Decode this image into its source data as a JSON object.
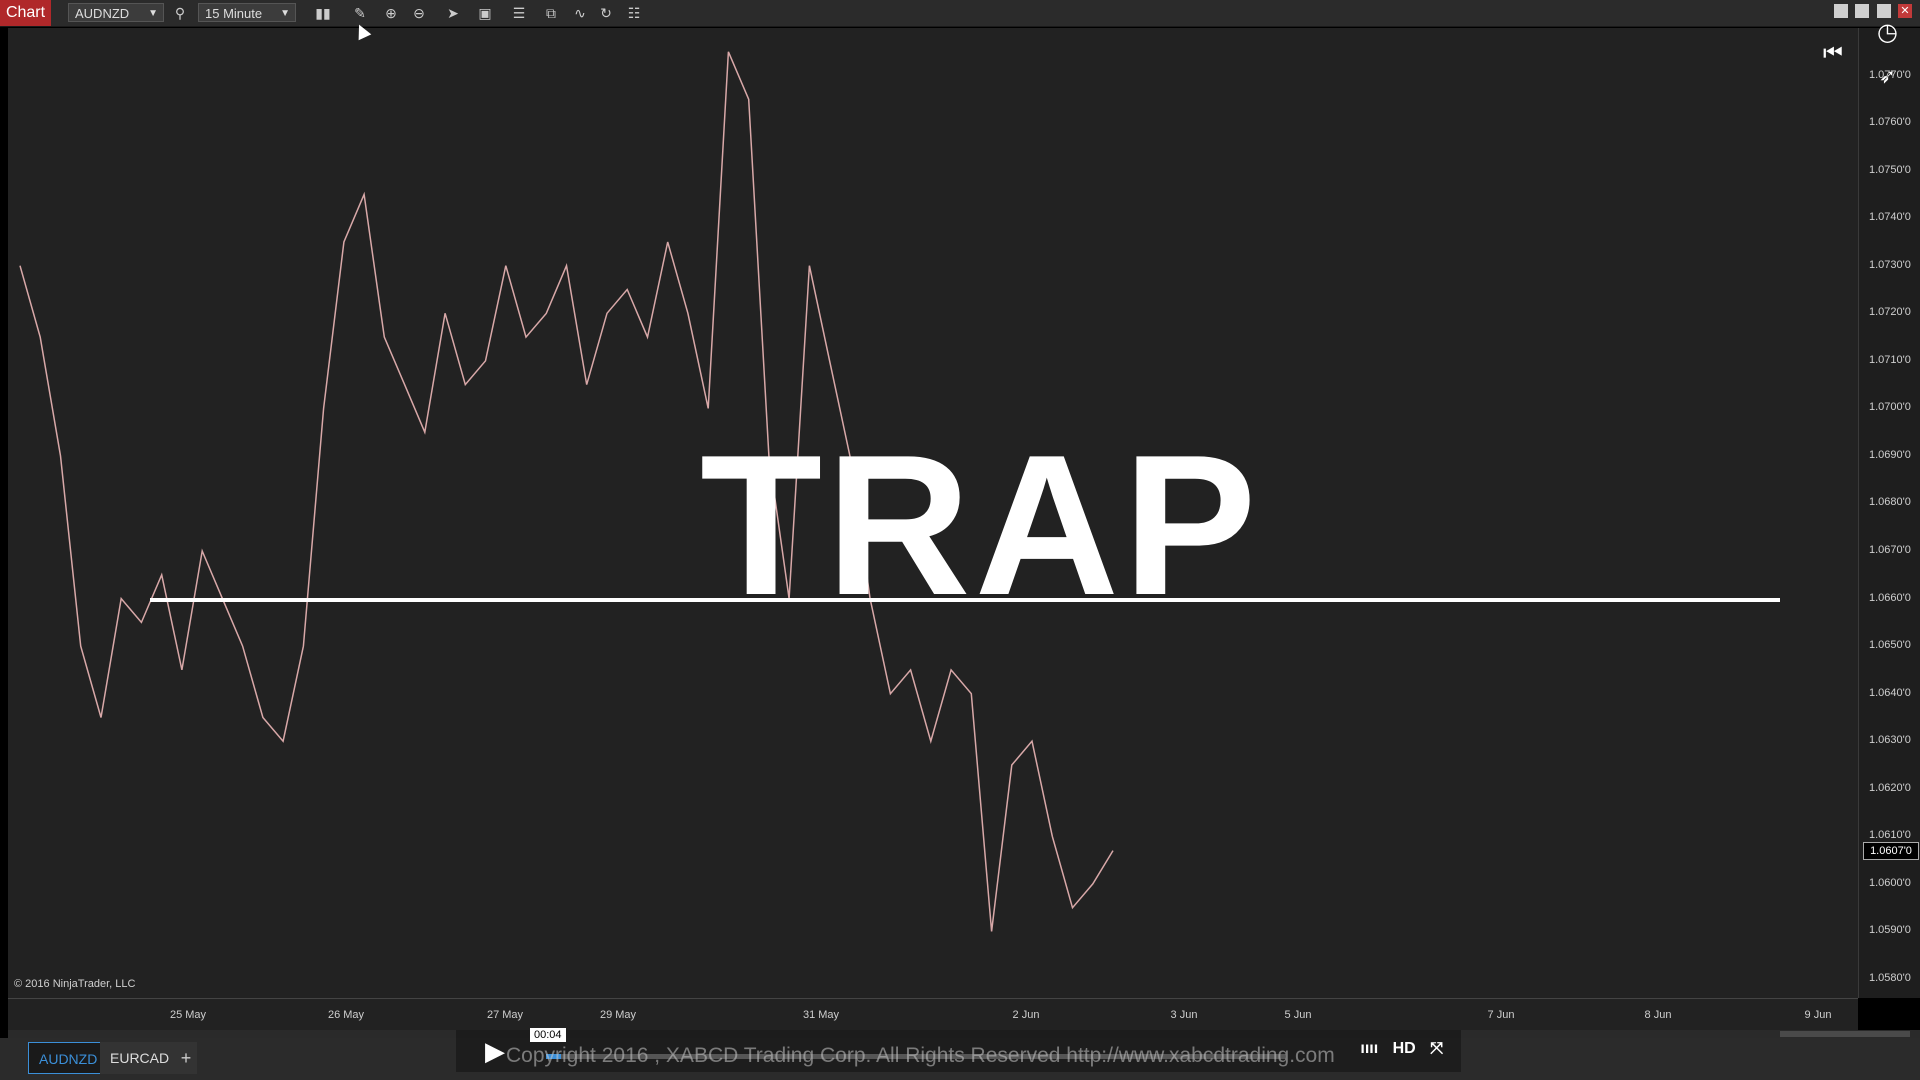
{
  "toolbar": {
    "chart_label": "Chart",
    "instrument": "AUDNZD",
    "interval": "15 Minute"
  },
  "chart_data": {
    "type": "line",
    "title": "",
    "instrument": "AUDNZD",
    "x": [
      "25 May",
      "26 May",
      "27 May",
      "29 May",
      "31 May",
      "2 Jun",
      "3 Jun",
      "5 Jun",
      "7 Jun",
      "8 Jun",
      "9 Jun"
    ],
    "price_ticks": [
      "1.0580'0",
      "1.0590'0",
      "1.0600'0",
      "1.0610'0",
      "1.0620'0",
      "1.0630'0",
      "1.0640'0",
      "1.0650'0",
      "1.0660'0",
      "1.0670'0",
      "1.0680'0",
      "1.0690'0",
      "1.0700'0",
      "1.0710'0",
      "1.0720'0",
      "1.0730'0",
      "1.0740'0",
      "1.0750'0",
      "1.0760'0",
      "1.0770'0"
    ],
    "ylim": [
      1.0576,
      1.078
    ],
    "last_price": "1.0607'0",
    "trap_level": 1.066,
    "series": [
      {
        "values": [
          1.073,
          1.0715,
          1.069,
          1.065,
          1.0635,
          1.066,
          1.0655,
          1.0665,
          1.0645,
          1.067,
          1.066,
          1.065,
          1.0635,
          1.063,
          1.065,
          1.07,
          1.0735,
          1.0745,
          1.0715,
          1.0705,
          1.0695,
          1.072,
          1.0705,
          1.071,
          1.073,
          1.0715,
          1.072,
          1.073,
          1.0705,
          1.072,
          1.0725,
          1.0715,
          1.0735,
          1.072,
          1.07,
          1.0775,
          1.0765,
          1.069,
          1.066,
          1.073,
          1.071,
          1.069,
          1.066,
          1.064,
          1.0645,
          1.063,
          1.0645,
          1.064,
          1.059,
          1.0625,
          1.063,
          1.061,
          1.0595,
          1.06,
          1.0607
        ]
      }
    ]
  },
  "copyright": "© 2016 NinjaTrader, LLC",
  "overlay_text": "TRAP",
  "tabs": [
    "AUDNZD",
    "EURCAD"
  ],
  "video": {
    "time": "00:04",
    "progress": 0.02,
    "caption": "Copyright 2016 , XABCD Trading Corp. All Rights Reserved  http://www.xabcdtrading.com",
    "hd": "HD"
  }
}
